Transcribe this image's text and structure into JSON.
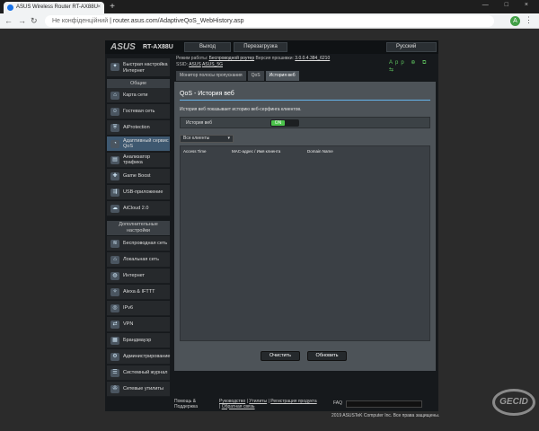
{
  "browser": {
    "tab_title": "ASUS Wireless Router RT-AX88U",
    "tab_close": "×",
    "new_tab": "+",
    "security_text": "Не конфіденційний",
    "url": "router.asus.com/AdaptiveQoS_WebHistory.asp",
    "avatar_letter": "A",
    "window_buttons": "— □ ×"
  },
  "router": {
    "logo": "ASUS",
    "model": "RT-AX88U",
    "logout_label": "Выход",
    "reboot_label": "Перезагрузка",
    "language_label": "Русский",
    "status": {
      "mode_label": "Режим работы:",
      "mode_value": "Беспроводной роутер",
      "fw_label": "Версия прошивки:",
      "fw_value": "3.0.0.4.384_6210",
      "ssid_label": "SSID:",
      "ssid1": "ASUS",
      "ssid2": "ASUS_5G",
      "app_label": "App"
    },
    "sidebar": {
      "quick": "Быстрая настройка Интернет",
      "general_header": "Общие",
      "general_items": [
        "Карта сети",
        "Гостевая сеть",
        "AiProtection",
        "Адаптивный сервис QoS",
        "Анализатор трафика",
        "Game Boost",
        "USB-приложение",
        "AiCloud 2.0"
      ],
      "advanced_header": "Дополнительные настройки",
      "advanced_items": [
        "Беспроводная сеть",
        "Локальная сеть",
        "Интернет",
        "Alexa & IFTTT",
        "IPv6",
        "VPN",
        "Брандмауэр",
        "Администрирование",
        "Системный журнал",
        "Сетевые утилиты"
      ]
    },
    "tabs": [
      "Монитор полосы пропускания",
      "QoS",
      "История веб"
    ],
    "content": {
      "title": "QoS - История веб",
      "description": "История веб показывает историю веб-серфинга клиентов.",
      "toggle_label": "История веб",
      "toggle_value": "ON",
      "filter_value": "Все клиенты",
      "columns": [
        "Access Time",
        "MAC-адрес / Имя клиента",
        "Domain Name"
      ],
      "clear_button": "Очистить",
      "refresh_button": "Обновить"
    },
    "footer": {
      "help": "Помощь & Поддержка",
      "links": [
        "Руководство",
        "Утилиты",
        "Регистрация продукта",
        "Обратная связь"
      ],
      "faq": "FAQ",
      "copyright": "2019 ASUSTeK Computer Inc. Все права защищены."
    }
  }
}
